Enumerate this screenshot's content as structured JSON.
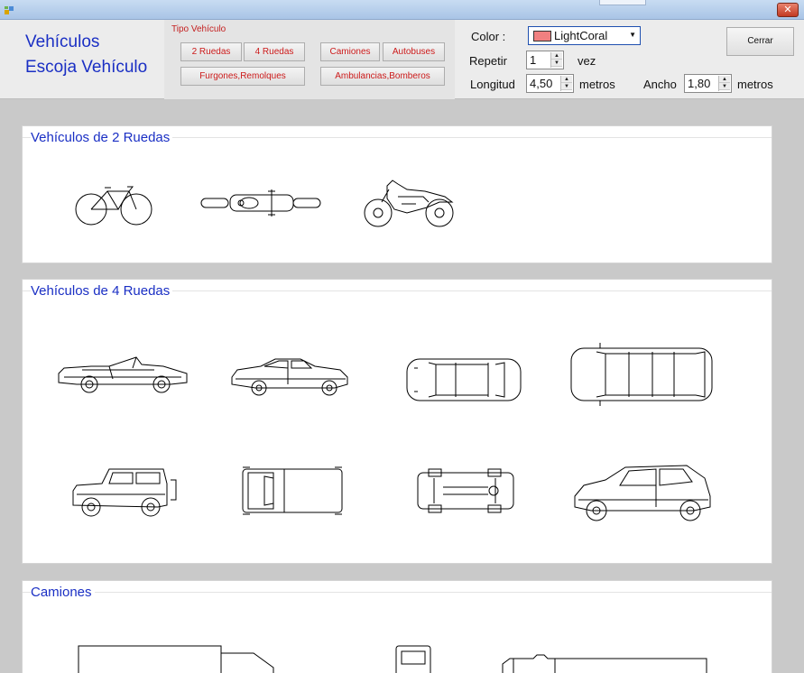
{
  "header": {
    "title_line1": "Vehículos",
    "title_line2": "Escoja Vehículo",
    "tipo_label": "Tipo Vehículo",
    "buttons": {
      "ruedas2": "2 Ruedas",
      "ruedas4": "4 Ruedas",
      "camiones": "Camiones",
      "autobuses": "Autobuses",
      "furgones": "Furgones,Remolques",
      "ambulancias": "Ambulancias,Bomberos"
    }
  },
  "options": {
    "color_label": "Color :",
    "color_value": "LightCoral",
    "color_hex": "#f08080",
    "repetir_label": "Repetir",
    "repetir_value": "1",
    "vez_label": "vez",
    "longitud_label": "Longitud",
    "longitud_value": "4,50",
    "metros_label": "metros",
    "ancho_label": "Ancho",
    "ancho_value": "1,80",
    "cerrar_label": "Cerrar"
  },
  "panels": {
    "dos_ruedas": {
      "title": "Vehículos de 2 Ruedas",
      "items": [
        "bicycle-side-icon",
        "motorcycle-top-icon",
        "motorcycle-side-icon"
      ]
    },
    "cuatro_ruedas": {
      "title": "Vehículos de 4 Ruedas",
      "items": [
        "convertible-side-icon",
        "sedan-side-icon",
        "car-top-icon",
        "minivan-top-icon",
        "jeep-side-icon",
        "pickup-top-icon",
        "chassis-top-icon",
        "minivan-side-icon"
      ]
    },
    "camiones": {
      "title": "Camiones"
    }
  },
  "colors": {
    "title_blue": "#1a2fc4",
    "button_red": "#cc1a1a"
  }
}
